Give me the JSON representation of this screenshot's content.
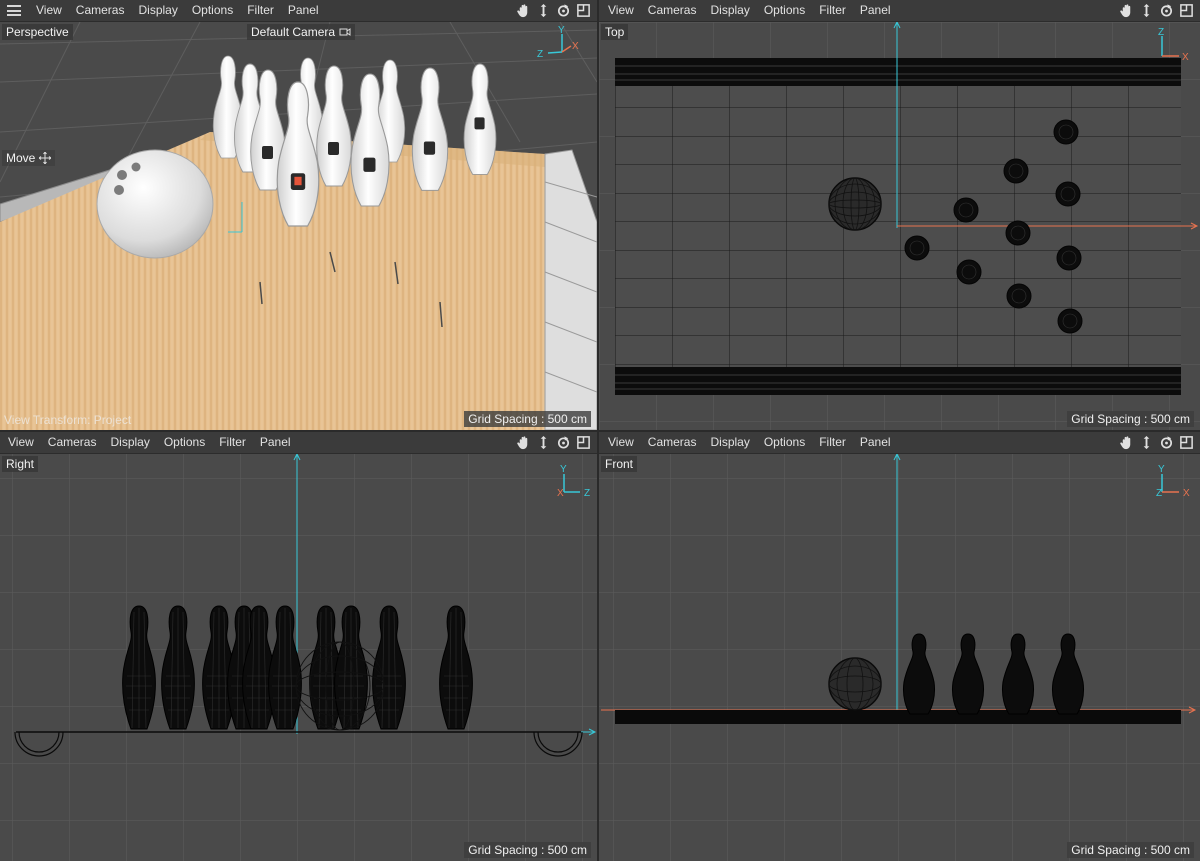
{
  "menus": [
    "View",
    "Cameras",
    "Display",
    "Options",
    "Filter",
    "Panel"
  ],
  "nav_icons": [
    "hand-pan-icon",
    "move-arrows-icon",
    "rotate-icon",
    "maximize-icon"
  ],
  "viewports": {
    "perspective": {
      "label": "Perspective",
      "camera": "Default Camera",
      "tool": "Move",
      "view_transform": "View Transform: Project",
      "grid_spacing": "Grid Spacing : 500 cm",
      "axes": [
        "Y",
        "Z",
        "X"
      ]
    },
    "top": {
      "label": "Top",
      "grid_spacing": "Grid Spacing : 500 cm",
      "axes": [
        "Z",
        "X"
      ]
    },
    "right": {
      "label": "Right",
      "grid_spacing": "Grid Spacing : 500 cm",
      "axes": [
        "Y",
        "X",
        "Z"
      ]
    },
    "front": {
      "label": "Front",
      "grid_spacing": "Grid Spacing : 500 cm",
      "axes": [
        "Y",
        "Z",
        "X"
      ]
    }
  },
  "colors": {
    "viewport_bg": "#4a4a4a",
    "menubar_bg": "#3b3b3b",
    "axis_x": "#e8734f",
    "axis_y": "#38c8d8",
    "axis_z": "#38c8d8",
    "lane_wood": "#e6c08f"
  }
}
